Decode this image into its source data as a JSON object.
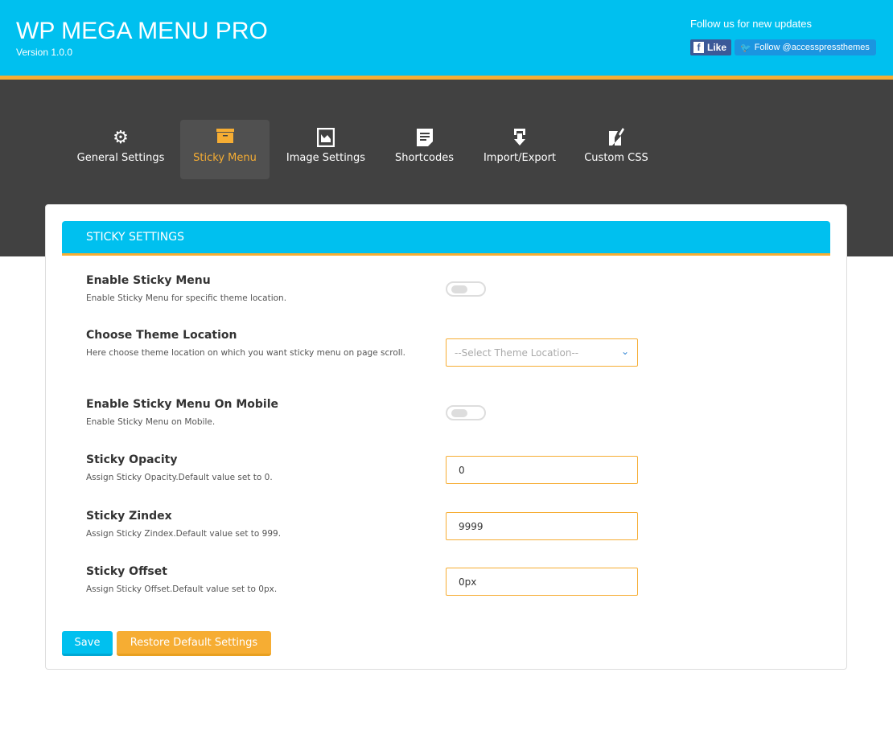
{
  "header": {
    "title": "WP MEGA MENU PRO",
    "version": "Version 1.0.0",
    "follow_text": "Follow us for new updates",
    "facebook_label": "Like",
    "twitter_label": "Follow @accesspressthemes"
  },
  "tabs": [
    {
      "label": "General Settings",
      "icon": "gear-icon"
    },
    {
      "label": "Sticky Menu",
      "icon": "archive-box-icon",
      "active": true
    },
    {
      "label": "Image Settings",
      "icon": "image-icon"
    },
    {
      "label": "Shortcodes",
      "icon": "document-icon"
    },
    {
      "label": "Import/Export",
      "icon": "import-arrow-icon"
    },
    {
      "label": "Custom CSS",
      "icon": "edit-icon"
    }
  ],
  "section": {
    "title": "STICKY SETTINGS"
  },
  "settings": [
    {
      "title": "Enable Sticky Menu",
      "desc": "Enable Sticky Menu for specific theme location.",
      "type": "toggle",
      "value": false
    },
    {
      "title": "Choose Theme Location",
      "desc": "Here choose theme location on which you want sticky menu on page scroll.",
      "type": "select",
      "value": "--Select Theme Location--"
    },
    {
      "title": "Enable Sticky Menu On Mobile",
      "desc": "Enable Sticky Menu on Mobile.",
      "type": "toggle",
      "value": false
    },
    {
      "title": "Sticky Opacity",
      "desc": "Assign Sticky Opacity.Default value set to 0.",
      "type": "text",
      "value": "0"
    },
    {
      "title": "Sticky Zindex",
      "desc": "Assign Sticky Zindex.Default value set to 999.",
      "type": "text",
      "value": "9999"
    },
    {
      "title": "Sticky Offset",
      "desc": "Assign Sticky Offset.Default value set to 0px.",
      "type": "text",
      "value": "0px"
    }
  ],
  "buttons": {
    "save": "Save",
    "restore": "Restore Default Settings"
  },
  "colors": {
    "primary": "#00c0ef",
    "accent": "#f6ad33",
    "dark": "#414141"
  }
}
